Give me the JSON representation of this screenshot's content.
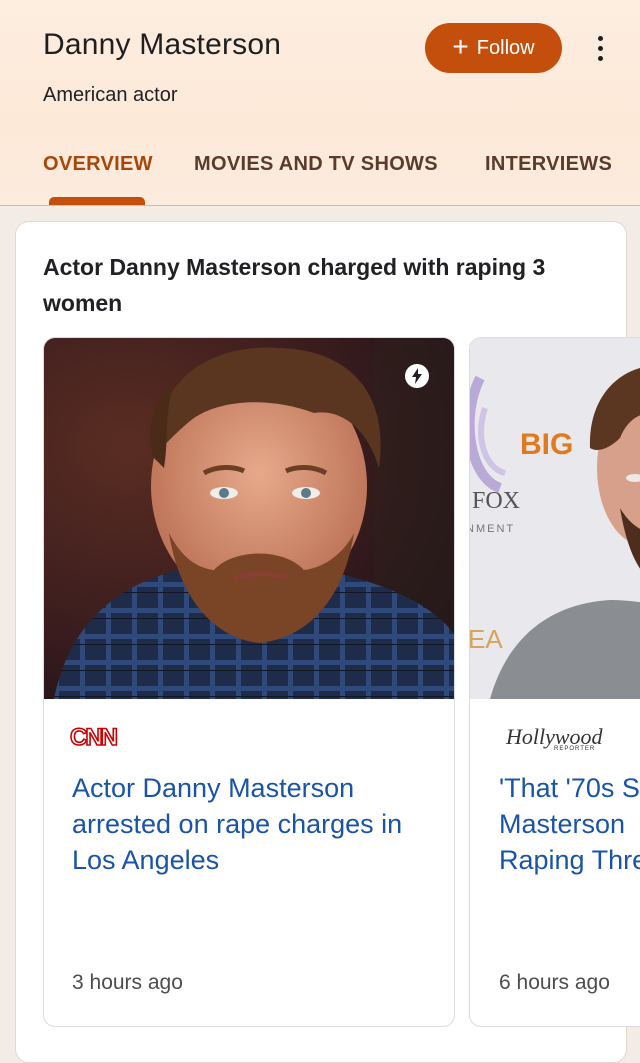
{
  "header": {
    "title": "Danny Masterson",
    "subtitle": "American actor",
    "follow_plus": "+",
    "follow_label": "Follow",
    "more_icon": "more-vert-icon"
  },
  "tabs": [
    {
      "label": "OVERVIEW",
      "selected": true
    },
    {
      "label": "MOVIES AND TV SHOWS",
      "selected": false
    },
    {
      "label": "INTERVIEWS",
      "selected": false
    }
  ],
  "story": {
    "headline": "Actor Danny Masterson charged with raping 3 women",
    "cards": [
      {
        "source": "CNN",
        "title": "Actor Danny Masterson arrested on rape charges in Los Angeles",
        "time": "3 hours ago",
        "badge_icon": "lightning-bolt-icon"
      },
      {
        "source": "Hollywood",
        "source_sub": "REPORTER",
        "title_lines": [
          "'That '70s S",
          "Masterson",
          "Raping Thre"
        ],
        "backdrop_text": [
          "BIG",
          "FOX",
          "NMENT",
          "EA"
        ],
        "time": "6 hours ago"
      }
    ]
  },
  "colors": {
    "accent": "#c44f0c",
    "link": "#1a54a8",
    "header_bg": "#fdeee1"
  }
}
